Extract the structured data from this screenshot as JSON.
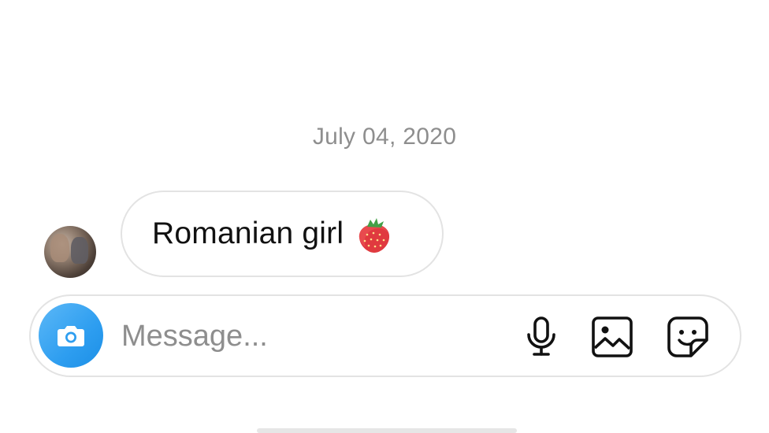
{
  "conversation": {
    "date_divider": "July 04, 2020",
    "messages": [
      {
        "sender": "other",
        "text": "Romanian girl",
        "emoji": "strawberry"
      }
    ]
  },
  "composer": {
    "placeholder": "Message...",
    "value": "",
    "icons": {
      "camera": "camera-icon",
      "mic": "microphone-icon",
      "gallery": "gallery-icon",
      "sticker": "sticker-icon"
    },
    "accent_color": "#3797f0"
  },
  "colors": {
    "date_text": "#8e8e8e",
    "bubble_border": "#e3e3e3",
    "message_text": "#111111"
  }
}
